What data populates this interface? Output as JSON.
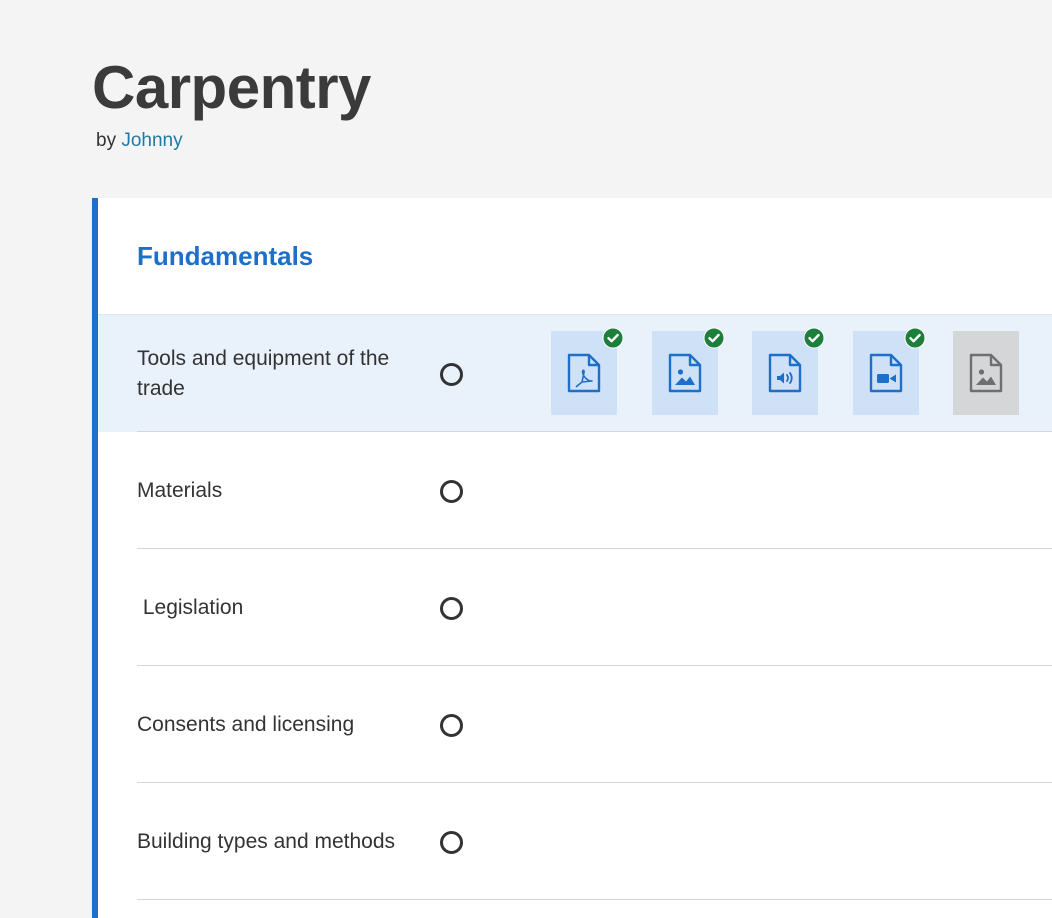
{
  "course": {
    "title": "Carpentry",
    "by_label": "by",
    "author": "Johnny"
  },
  "section": {
    "title": "Fundamentals"
  },
  "lessons": [
    {
      "label": "Tools and equipment of the trade",
      "status": "not-started",
      "active": true,
      "resources": [
        {
          "type": "pdf",
          "icon": "pdf-file-icon",
          "completed": true
        },
        {
          "type": "image",
          "icon": "image-file-icon",
          "completed": true
        },
        {
          "type": "audio",
          "icon": "audio-file-icon",
          "completed": true
        },
        {
          "type": "video",
          "icon": "video-file-icon",
          "completed": true
        },
        {
          "type": "image",
          "icon": "image-file-icon",
          "completed": false
        }
      ]
    },
    {
      "label": "Materials",
      "status": "not-started",
      "active": false,
      "resources": []
    },
    {
      "label": " Legislation",
      "status": "not-started",
      "active": false,
      "resources": []
    },
    {
      "label": "Consents and licensing",
      "status": "not-started",
      "active": false,
      "resources": []
    },
    {
      "label": "Building types and methods",
      "status": "not-started",
      "active": false,
      "resources": []
    }
  ],
  "colors": {
    "accent": "#1e6fc9",
    "link": "#1f7aa8",
    "active_row": "#e9f1fb",
    "resource_bg": "#cfe1f6",
    "resource_pending_bg": "#d4d6d8",
    "check": "#1e7f3c"
  }
}
